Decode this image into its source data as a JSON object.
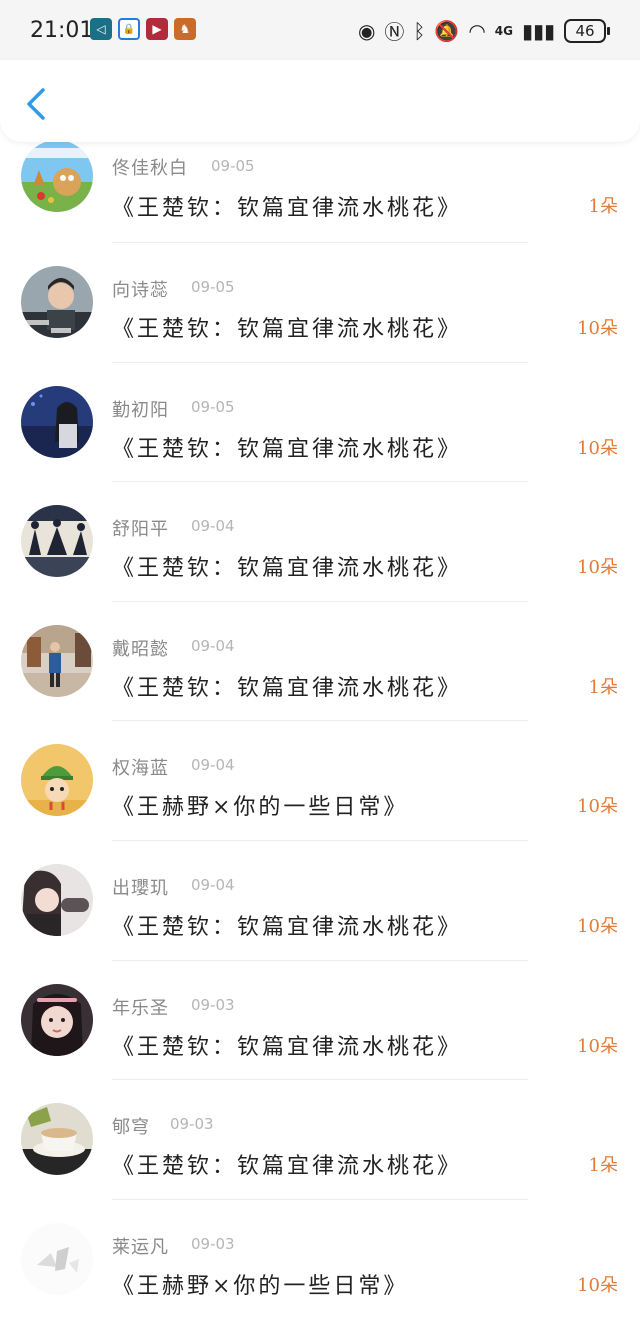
{
  "status_bar": {
    "time": "21:01",
    "battery": "46",
    "network": "4G",
    "notification_icons": [
      "navigation-app-icon",
      "lock-app-icon",
      "video-app-icon",
      "game-app-icon"
    ]
  },
  "header": {
    "back_icon": "chevron-left-icon",
    "accent_color": "#2f9be8"
  },
  "colors": {
    "flower_count": "#e07c3a",
    "name": "#8a8a8a",
    "date": "#b5b5b5"
  },
  "items": [
    {
      "name": "佟佳秋白",
      "date": "09-05",
      "title": "《王楚钦：钦篇宜律流水桃花》",
      "flowers": "1朵",
      "avatar": "cartoon-farm-avatar"
    },
    {
      "name": "向诗蕊",
      "date": "09-05",
      "title": "《王楚钦：钦篇宜律流水桃花》",
      "flowers": "10朵",
      "avatar": "boy-photo-avatar"
    },
    {
      "name": "勤初阳",
      "date": "09-05",
      "title": "《王楚钦：钦篇宜律流水桃花》",
      "flowers": "10朵",
      "avatar": "girl-night-avatar"
    },
    {
      "name": "舒阳平",
      "date": "09-04",
      "title": "《王楚钦：钦篇宜律流水桃花》",
      "flowers": "10朵",
      "avatar": "yoga-silhouette-avatar"
    },
    {
      "name": "戴昭懿",
      "date": "09-04",
      "title": "《王楚钦：钦篇宜律流水桃花》",
      "flowers": "1朵",
      "avatar": "street-walk-avatar"
    },
    {
      "name": "权海蓝",
      "date": "09-04",
      "title": "《王赫野×你的一些日常》",
      "flowers": "10朵",
      "avatar": "cartoon-soldier-avatar"
    },
    {
      "name": "出瓔玑",
      "date": "09-04",
      "title": "《王楚钦：钦篇宜律流水桃花》",
      "flowers": "10朵",
      "avatar": "girl-selfie-avatar"
    },
    {
      "name": "年乐圣",
      "date": "09-03",
      "title": "《王楚钦：钦篇宜律流水桃花》",
      "flowers": "10朵",
      "avatar": "girl-portrait-avatar"
    },
    {
      "name": "郇穹",
      "date": "09-03",
      "title": "《王楚钦：钦篇宜律流水桃花》",
      "flowers": "1朵",
      "avatar": "coffee-cup-avatar"
    },
    {
      "name": "莱运凡",
      "date": "09-03",
      "title": "《王赫野×你的一些日常》",
      "flowers": "10朵",
      "avatar": "blank-sketch-avatar"
    }
  ]
}
